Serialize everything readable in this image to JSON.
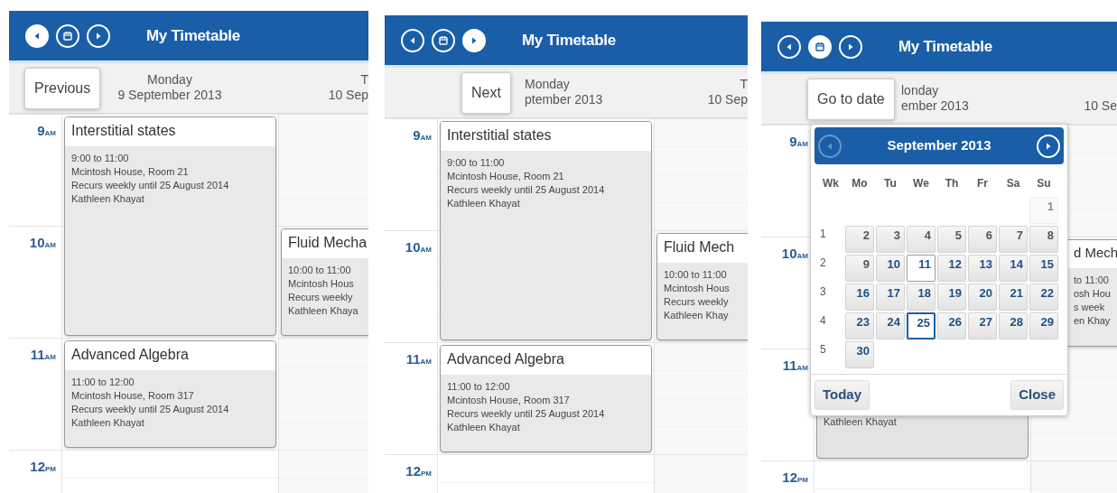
{
  "panels": [
    {
      "header": {
        "buttons": [
          {
            "kind": "previous",
            "selected": true
          },
          {
            "kind": "calendar",
            "selected": false
          },
          {
            "kind": "next",
            "selected": false
          }
        ],
        "title": "My Timetable"
      },
      "tooltip": "Previous",
      "times": [
        {
          "hour": "9",
          "period": "AM"
        },
        {
          "hour": "10",
          "period": "AM"
        },
        {
          "hour": "11",
          "period": "AM"
        },
        {
          "hour": "12",
          "period": "PM"
        }
      ],
      "days": [
        {
          "name": "Monday",
          "date": "9 September 2013",
          "kind": "nine",
          "events": [
            {
              "kind": "long",
              "title": "Interstitial states",
              "lines": [
                "9:00 to 11:00",
                "Mcintosh House, Room 21",
                "Recurs weekly until 25 August 2014",
                "Kathleen Khayat"
              ]
            },
            {
              "kind": "short",
              "title": "Advanced Algebra",
              "lines": [
                "11:00 to 12:00",
                "Mcintosh House, Room 317",
                "Recurs weekly until 25 August 2014",
                "Kathleen Khayat"
              ]
            }
          ]
        },
        {
          "name": "T",
          "date": "10 Sep",
          "kind": "ten",
          "events": [
            {
              "kind": "short",
              "title": "Fluid Mecha",
              "lines": [
                "10:00 to 11:00",
                "Mcintosh Hous",
                "Recurs weekly",
                "Kathleen Khaya"
              ]
            }
          ]
        }
      ]
    },
    {
      "header": {
        "buttons": [
          {
            "kind": "previous",
            "selected": false
          },
          {
            "kind": "calendar",
            "selected": false
          },
          {
            "kind": "next",
            "selected": true
          }
        ],
        "title": "My Timetable"
      },
      "tooltip": "Next",
      "times": [
        {
          "hour": "9",
          "period": "AM"
        },
        {
          "hour": "10",
          "period": "AM"
        },
        {
          "hour": "11",
          "period": "AM"
        },
        {
          "hour": "12",
          "period": "PM"
        }
      ],
      "days": [
        {
          "name": "Monday",
          "date": "ptember 2013",
          "kind": "nine",
          "events": [
            {
              "kind": "long",
              "title": "Interstitial states",
              "lines": [
                "9:00 to 11:00",
                "Mcintosh House, Room 21",
                "Recurs weekly until 25 August 2014",
                "Kathleen Khayat"
              ]
            },
            {
              "kind": "short",
              "title": "Advanced Algebra",
              "lines": [
                "11:00 to 12:00",
                "Mcintosh House, Room 317",
                "Recurs weekly until 25 August 2014",
                "Kathleen Khayat"
              ]
            }
          ]
        },
        {
          "name": "T",
          "date": "10 Sep",
          "kind": "ten",
          "events": [
            {
              "kind": "short",
              "title": "Fluid Mech",
              "lines": [
                "10:00 to 11:00",
                "Mcintosh Hous",
                "Recurs weekly",
                "Kathleen Khay"
              ]
            }
          ]
        }
      ]
    },
    {
      "header": {
        "buttons": [
          {
            "kind": "previous",
            "selected": false
          },
          {
            "kind": "calendar",
            "selected": true
          },
          {
            "kind": "next",
            "selected": false
          }
        ],
        "title": "My Timetable"
      },
      "tooltip": "Go to date",
      "times": [
        {
          "hour": "9",
          "period": "AM"
        },
        {
          "hour": "10",
          "period": "AM"
        },
        {
          "hour": "11",
          "period": "AM"
        },
        {
          "hour": "12",
          "period": "PM"
        }
      ],
      "days": [
        {
          "name": "londay",
          "date": "ember 2013",
          "kind": "eleven",
          "events": [
            {
              "kind": "tail",
              "lines": [
                "Kathleen Khayat"
              ]
            }
          ]
        },
        {
          "date": "10 Se",
          "kind": "ten",
          "events": [
            {
              "kind": "side",
              "title": "d Mech",
              "lines": [
                "to 11:00",
                "osh Hou",
                "s week",
                "en Khay"
              ]
            }
          ]
        }
      ],
      "datepicker": {
        "nav": [
          {
            "kind": "previous",
            "disabled": true
          },
          {
            "kind": "next",
            "disabled": false
          }
        ],
        "title": "September 2013",
        "weekdays": [
          "Wk",
          "Mo",
          "Tu",
          "We",
          "Th",
          "Fr",
          "Sa",
          "Su"
        ],
        "weeks": [
          {
            "days": [
              {
                "day": "1",
                "kind": "faint",
                "highlighted": false,
                "selected": false
              }
            ]
          },
          {
            "number": "1",
            "days": [
              {
                "day": "2",
                "kind": "grey",
                "highlighted": false,
                "selected": false
              },
              {
                "day": "3",
                "kind": "grey",
                "highlighted": false,
                "selected": false
              },
              {
                "day": "4",
                "kind": "grey",
                "highlighted": false,
                "selected": false
              },
              {
                "day": "5",
                "kind": "grey",
                "highlighted": false,
                "selected": false
              },
              {
                "day": "6",
                "kind": "grey",
                "highlighted": false,
                "selected": false
              },
              {
                "day": "7",
                "kind": "grey",
                "highlighted": false,
                "selected": false
              },
              {
                "day": "8",
                "kind": "grey",
                "highlighted": false,
                "selected": false
              }
            ]
          },
          {
            "number": "2",
            "days": [
              {
                "day": "9",
                "kind": "grey",
                "highlighted": false,
                "selected": false
              },
              {
                "day": "10",
                "kind": "blue",
                "highlighted": false,
                "selected": false
              },
              {
                "day": "11",
                "kind": "blue",
                "highlighted": true,
                "selected": false
              },
              {
                "day": "12",
                "kind": "blue",
                "highlighted": false,
                "selected": false
              },
              {
                "day": "13",
                "kind": "blue",
                "highlighted": false,
                "selected": false
              },
              {
                "day": "14",
                "kind": "blue",
                "highlighted": false,
                "selected": false
              },
              {
                "day": "15",
                "kind": "blue",
                "highlighted": false,
                "selected": false
              }
            ]
          },
          {
            "number": "3",
            "days": [
              {
                "day": "16",
                "kind": "blue",
                "highlighted": false,
                "selected": false
              },
              {
                "day": "17",
                "kind": "blue",
                "highlighted": false,
                "selected": false
              },
              {
                "day": "18",
                "kind": "blue",
                "highlighted": false,
                "selected": false
              },
              {
                "day": "19",
                "kind": "blue",
                "highlighted": false,
                "selected": false
              },
              {
                "day": "20",
                "kind": "blue",
                "highlighted": false,
                "selected": false
              },
              {
                "day": "21",
                "kind": "blue",
                "highlighted": false,
                "selected": false
              },
              {
                "day": "22",
                "kind": "blue",
                "highlighted": false,
                "selected": false
              }
            ]
          },
          {
            "number": "4",
            "days": [
              {
                "day": "23",
                "kind": "blue",
                "highlighted": false,
                "selected": false
              },
              {
                "day": "24",
                "kind": "blue",
                "highlighted": false,
                "selected": false
              },
              {
                "day": "25",
                "kind": "blue",
                "highlighted": false,
                "selected": true
              },
              {
                "day": "26",
                "kind": "blue",
                "highlighted": false,
                "selected": false
              },
              {
                "day": "27",
                "kind": "blue",
                "highlighted": false,
                "selected": false
              },
              {
                "day": "28",
                "kind": "blue",
                "highlighted": false,
                "selected": false
              },
              {
                "day": "29",
                "kind": "blue",
                "highlighted": false,
                "selected": false
              }
            ]
          },
          {
            "number": "5",
            "days": [
              {
                "day": "30",
                "kind": "blue",
                "highlighted": false,
                "selected": false
              }
            ]
          }
        ],
        "buttons": [
          "Today",
          "Close"
        ]
      }
    }
  ]
}
